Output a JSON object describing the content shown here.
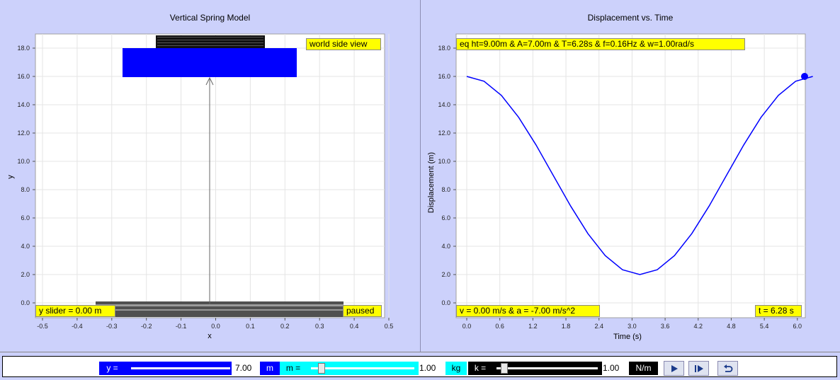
{
  "left_panel": {
    "title": "Vertical Spring Model",
    "view_label": "world side view",
    "status_label": "y slider = 0.00 m",
    "state_label": "paused",
    "x_axis_label": "x",
    "y_axis_label": "y",
    "x_ticks": [
      "-0.5",
      "-0.4",
      "-0.3",
      "-0.2",
      "-0.1",
      "0.0",
      "0.1",
      "0.2",
      "0.3",
      "0.4",
      "0.5"
    ],
    "y_ticks": [
      "0.0",
      "2.0",
      "4.0",
      "6.0",
      "8.0",
      "10.0",
      "12.0",
      "14.0",
      "16.0",
      "18.0"
    ],
    "colors": {
      "mass": "#0000ff",
      "label_bg": "#ffff00"
    }
  },
  "right_panel": {
    "title": "Displacement vs. Time",
    "equation_label": "eq ht=9.00m & A=7.00m & T=6.28s & f=0.16Hz & w=1.00rad/s",
    "velocity_label": "v = 0.00 m/s & a = -7.00 m/s^2",
    "time_label": "t = 6.28 s",
    "x_axis_label": "Time (s)",
    "y_axis_label": "Displacement (m)",
    "x_ticks": [
      "0.0",
      "0.6",
      "1.2",
      "1.8",
      "2.4",
      "3.0",
      "3.6",
      "4.2",
      "4.8",
      "5.4",
      "6.0"
    ],
    "y_ticks": [
      "0.0",
      "2.0",
      "4.0",
      "6.0",
      "8.0",
      "10.0",
      "12.0",
      "14.0",
      "16.0",
      "18.0"
    ]
  },
  "chart_data": {
    "type": "line",
    "title": "Displacement vs. Time",
    "xlabel": "Time (s)",
    "ylabel": "Displacement (m)",
    "xlim": [
      -0.2,
      6.3
    ],
    "ylim": [
      -1,
      19
    ],
    "grid": true,
    "series": [
      {
        "values_x": [
          0.0,
          0.314,
          0.628,
          0.942,
          1.257,
          1.571,
          1.885,
          2.199,
          2.513,
          2.827,
          3.142,
          3.456,
          3.77,
          4.084,
          4.398,
          4.712,
          5.027,
          5.341,
          5.655,
          5.969,
          6.28
        ],
        "values_y": [
          16.0,
          15.66,
          14.66,
          13.11,
          11.16,
          9.0,
          6.84,
          4.89,
          3.34,
          2.34,
          2.0,
          2.34,
          3.34,
          4.89,
          6.84,
          9.0,
          11.16,
          13.11,
          14.66,
          15.66,
          16.0
        ],
        "color": "#0000ff"
      }
    ],
    "current_point": {
      "x": 6.28,
      "y": 16.0
    }
  },
  "controls": {
    "y_label": "y =",
    "y_value": "7.00",
    "y_unit": "m",
    "y_level": 1.0,
    "m_label": "m =",
    "m_value": "1.00",
    "m_unit": "kg",
    "m_level": 0.1,
    "k_label": "k =",
    "k_value": "1.00",
    "k_unit": "N/m",
    "k_level": 0.1,
    "buttons": [
      "play-icon",
      "step-icon",
      "reset-icon"
    ],
    "colors": {
      "y_bg": "#0000ff",
      "m_bg": "#00ffff",
      "k_bg": "#000000"
    }
  }
}
